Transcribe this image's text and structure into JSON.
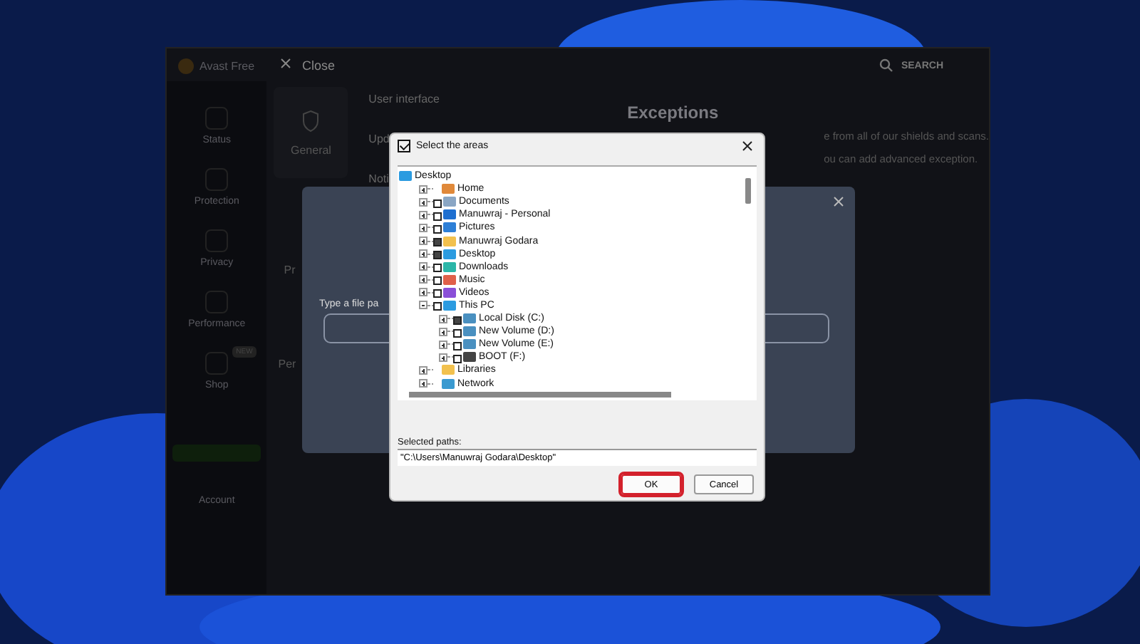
{
  "app": {
    "title": "Avast Free",
    "close": "Close",
    "search": "SEARCH",
    "sidebar": [
      {
        "label": "Status"
      },
      {
        "label": "Protection"
      },
      {
        "label": "Privacy"
      },
      {
        "label": "Performance"
      },
      {
        "label": "Shop",
        "badge": "NEW"
      }
    ],
    "account": "Account",
    "category": "General",
    "fragments": [
      "Pr",
      "Per"
    ],
    "settings_list": [
      "User interface",
      "Upd",
      "Noti"
    ],
    "page_title": "Exceptions",
    "description": [
      "e from all of our shields and scans.",
      "ou can add advanced exception."
    ]
  },
  "modal": {
    "field_label": "Type a file pa"
  },
  "dialog": {
    "title": "Select the areas",
    "tree": {
      "label": "Desktop",
      "kind": "desktop",
      "children": [
        {
          "label": "Home",
          "kind": "home",
          "expanded": false
        },
        {
          "label": "Documents",
          "kind": "document",
          "checked": false,
          "expanded": false
        },
        {
          "label": "Manuwraj - Personal",
          "kind": "cloud",
          "checked": false,
          "expanded": false
        },
        {
          "label": "Pictures",
          "kind": "pictures",
          "checked": false,
          "expanded": false
        },
        {
          "label": "Manuwraj Godara",
          "kind": "folder",
          "checked": true,
          "expanded": false
        },
        {
          "label": "Desktop",
          "kind": "desktop",
          "checked": true,
          "expanded": false
        },
        {
          "label": "Downloads",
          "kind": "download",
          "checked": false,
          "expanded": false
        },
        {
          "label": "Music",
          "kind": "music",
          "checked": false,
          "expanded": false
        },
        {
          "label": "Videos",
          "kind": "video",
          "checked": false,
          "expanded": false
        },
        {
          "label": "This PC",
          "kind": "desktop",
          "checked": false,
          "expanded": true,
          "children": [
            {
              "label": "Local Disk (C:)",
              "kind": "drive",
              "checked": true,
              "expanded": false
            },
            {
              "label": "New Volume (D:)",
              "kind": "drive",
              "checked": false,
              "expanded": false
            },
            {
              "label": "New Volume (E:)",
              "kind": "drive",
              "checked": false,
              "expanded": false
            },
            {
              "label": "BOOT (F:)",
              "kind": "usb",
              "checked": false,
              "expanded": false
            }
          ]
        },
        {
          "label": "Libraries",
          "kind": "folder",
          "expanded": false
        },
        {
          "label": "Network",
          "kind": "network",
          "expanded": false
        }
      ]
    },
    "paths_label": "Selected paths:",
    "paths_value": "\"C:\\Users\\Manuwraj Godara\\Desktop\"",
    "buttons": [
      {
        "label": "OK",
        "selected": true
      },
      {
        "label": "Cancel",
        "selected": false
      }
    ]
  }
}
